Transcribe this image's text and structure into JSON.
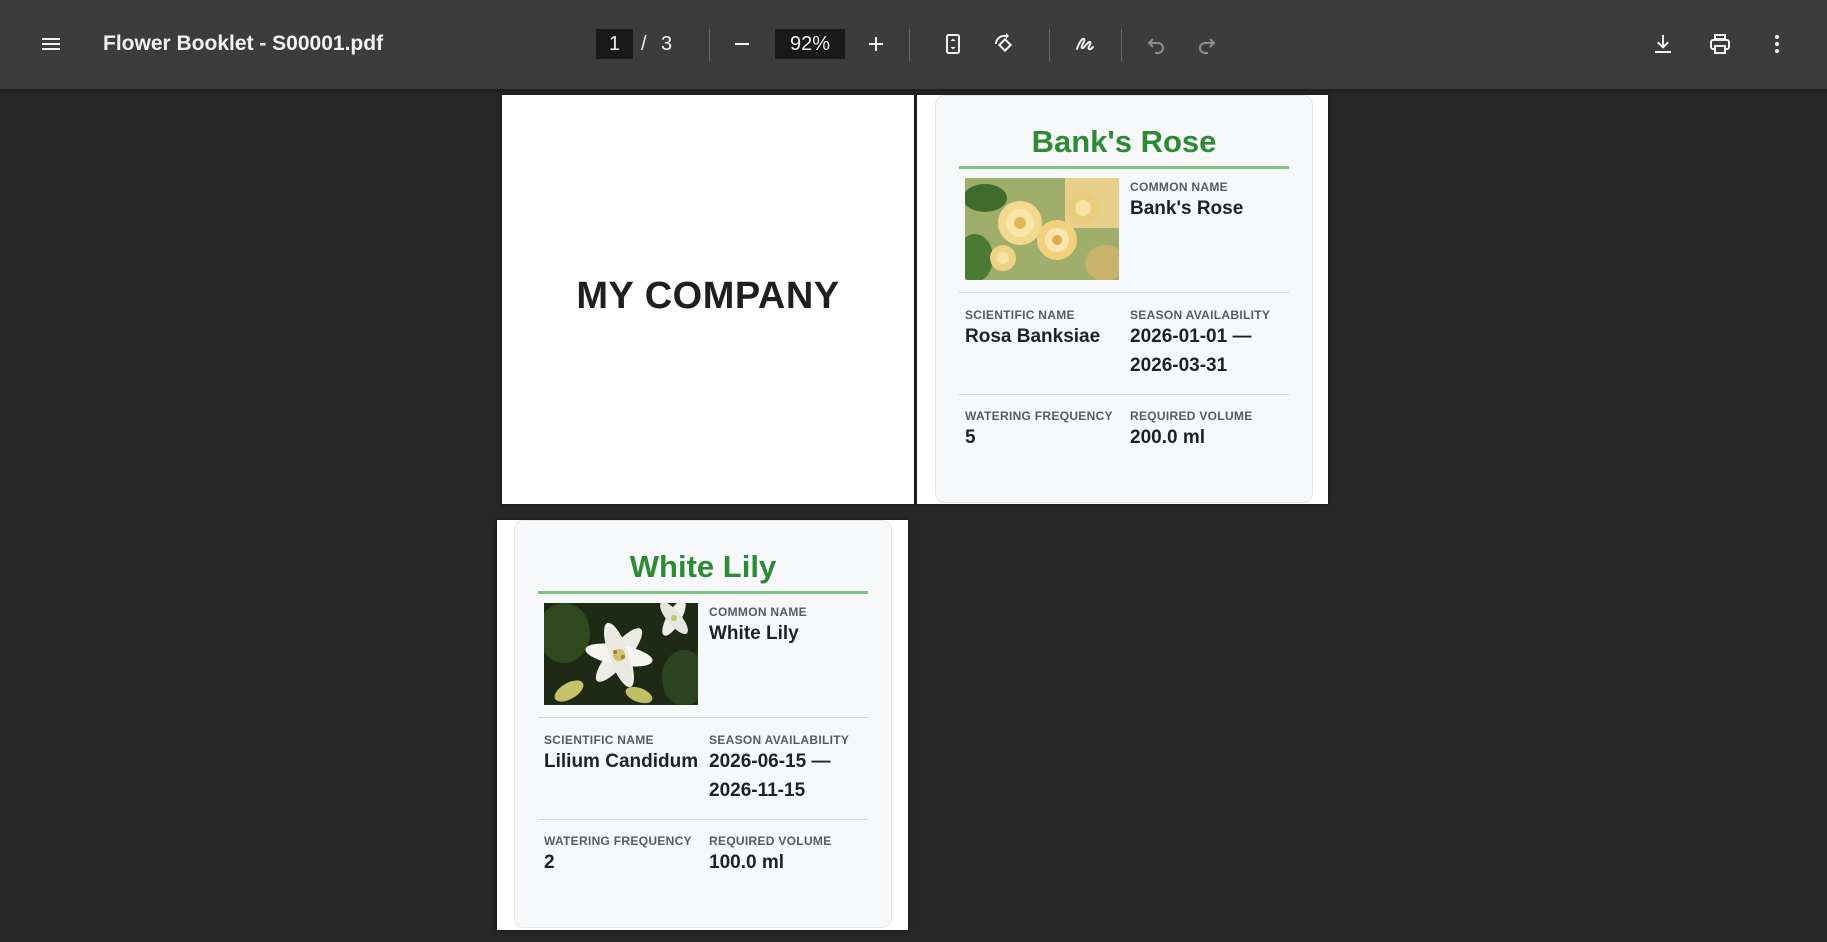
{
  "toolbar": {
    "title": "Flower Booklet - S00001.pdf",
    "current_page": "1",
    "page_separator": "/",
    "total_pages": "3",
    "zoom": "92%"
  },
  "cover": {
    "company": "MY COMPANY"
  },
  "cards": [
    {
      "title": "Bank's Rose",
      "common_name_label": "COMMON NAME",
      "common_name": "Bank's Rose",
      "scientific_name_label": "SCIENTIFIC NAME",
      "scientific_name": "Rosa Banksiae",
      "season_label": "SEASON AVAILABILITY",
      "season_start": "2026-01-01 —",
      "season_end": "2026-03-31",
      "watering_label": "WATERING FREQUENCY",
      "watering": "5",
      "volume_label": "REQUIRED VOLUME",
      "volume": "200.0 ml"
    },
    {
      "title": "White Lily",
      "common_name_label": "COMMON NAME",
      "common_name": "White Lily",
      "scientific_name_label": "SCIENTIFIC NAME",
      "scientific_name": "Lilium Candidum",
      "season_label": "SEASON AVAILABILITY",
      "season_start": "2026-06-15 —",
      "season_end": "2026-11-15",
      "watering_label": "WATERING FREQUENCY",
      "watering": "2",
      "volume_label": "REQUIRED VOLUME",
      "volume": "100.0 ml"
    }
  ],
  "colors": {
    "toolbar_bg": "#3c3c3c",
    "viewer_bg": "#282828",
    "card_title": "#2e8b35",
    "title_rule": "#7cc47f"
  },
  "icons": [
    "menu-icon",
    "zoom-out-icon",
    "zoom-in-icon",
    "fit-page-icon",
    "rotate-icon",
    "annotate-icon",
    "undo-icon",
    "redo-icon",
    "download-icon",
    "print-icon",
    "more-vert-icon"
  ]
}
